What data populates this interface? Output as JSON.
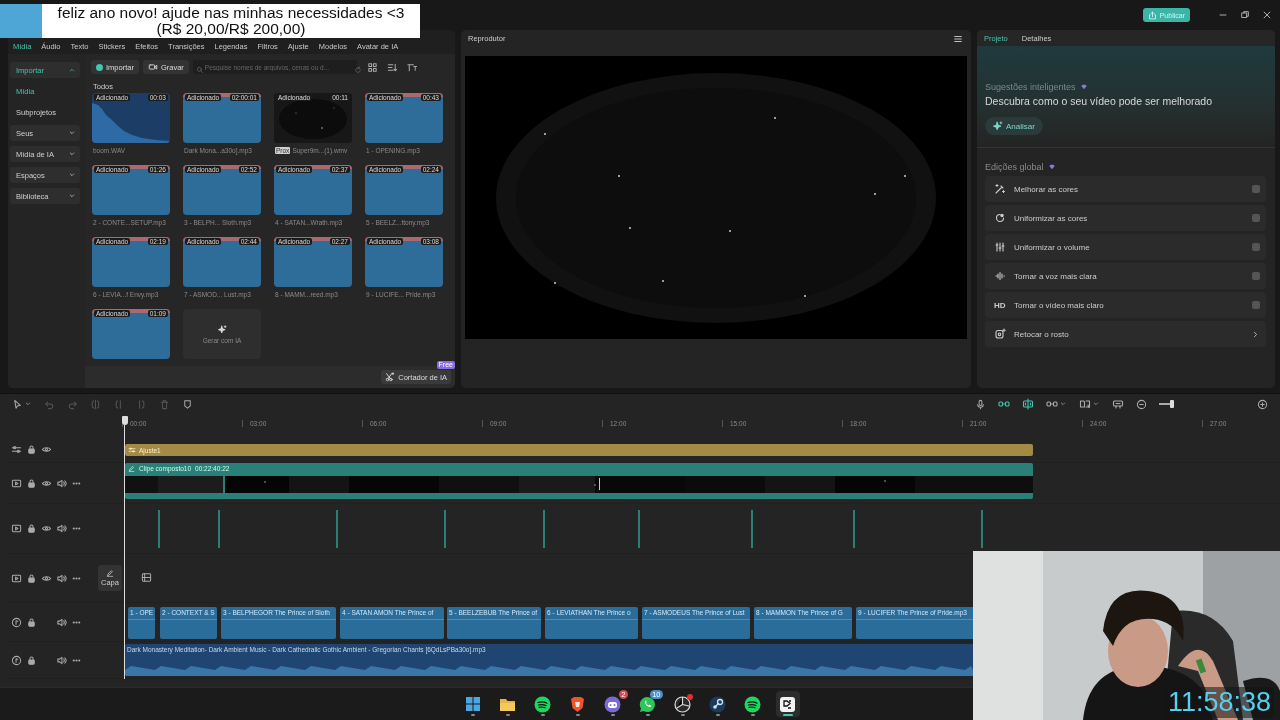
{
  "donation_banner": {
    "lines": [
      "feliz ano novo! ajude nas minhas necessidades <3",
      "(R$ 20,00/R$ 200,00)"
    ]
  },
  "title_bar": {
    "publish_button": "Publicar"
  },
  "media_tabs": [
    {
      "label": "Mídia",
      "selected": true
    },
    {
      "label": "Áudio",
      "selected": false
    },
    {
      "label": "Texto",
      "selected": false
    },
    {
      "label": "Stickers",
      "selected": false
    },
    {
      "label": "Efeitos",
      "selected": false
    },
    {
      "label": "Transições",
      "selected": false
    },
    {
      "label": "Legendas",
      "selected": false
    },
    {
      "label": "Filtros",
      "selected": false
    },
    {
      "label": "Ajuste",
      "selected": false
    },
    {
      "label": "Modelos",
      "selected": false
    },
    {
      "label": "Avatar de IA",
      "selected": false
    }
  ],
  "media_sidebar": [
    {
      "label": "Importar",
      "kind": "group",
      "expanded": true,
      "selected": true
    },
    {
      "label": "Mídia",
      "kind": "link",
      "selected": true
    },
    {
      "label": "Subprojetos",
      "kind": "link",
      "selected": false
    },
    {
      "label": "Seus",
      "kind": "group",
      "expanded": false,
      "selected": false
    },
    {
      "label": "Mídia de IA",
      "kind": "group",
      "expanded": false,
      "selected": false
    },
    {
      "label": "Espaços",
      "kind": "group",
      "expanded": false,
      "selected": false
    },
    {
      "label": "Biblioteca",
      "kind": "group",
      "expanded": false,
      "selected": false
    }
  ],
  "media_toolbar": {
    "import_button": "Importar",
    "record_button": "Gravar",
    "search_placeholder": "Pesquise nomes de arquivos, cenas ou d..."
  },
  "media_section": "Todos",
  "media_items": [
    {
      "kind": "sfx",
      "status": "Adicionado",
      "duration": "00:03",
      "name": "boom.WAV"
    },
    {
      "kind": "audio",
      "status": "Adicionado",
      "duration": "02:00:01",
      "name": "Dark Mona...a30o].mp3"
    },
    {
      "kind": "video",
      "status": "Adicionado",
      "duration": "00:11",
      "tag": "Prox",
      "name": "Super9m...(1).wmv"
    },
    {
      "kind": "audio",
      "status": "Adicionado",
      "duration": "00:43",
      "name": "1 - OPENING.mp3"
    },
    {
      "kind": "audio",
      "status": "Adicionado",
      "duration": "01:26",
      "name": "2 - CONTE...SETUP.mp3"
    },
    {
      "kind": "audio",
      "status": "Adicionado",
      "duration": "02:52",
      "name": "3 -  BELPH... Sloth.mp3"
    },
    {
      "kind": "audio",
      "status": "Adicionado",
      "duration": "02:37",
      "name": "4 - SATAN...Wrath.mp3"
    },
    {
      "kind": "audio",
      "status": "Adicionado",
      "duration": "02:24",
      "name": "5 - BEELZ...ttony.mp3"
    },
    {
      "kind": "audio",
      "status": "Adicionado",
      "duration": "02:19",
      "name": "6 -  LEVIA...f Envy.mp3"
    },
    {
      "kind": "audio",
      "status": "Adicionado",
      "duration": "02:44",
      "name": "7 - ASMOD... Lust.mp3"
    },
    {
      "kind": "audio",
      "status": "Adicionado",
      "duration": "02:27",
      "name": "8 - MAMM...reed.mp3"
    },
    {
      "kind": "audio",
      "status": "Adicionado",
      "duration": "03:08",
      "name": "9 - LUCIFE... Pride.mp3"
    },
    {
      "kind": "audio",
      "status": "Adicionado",
      "duration": "01:09"
    }
  ],
  "generate_tile": "Gerar com IA",
  "ai_cutter": {
    "label": "Cortador de IA",
    "badge": "Free"
  },
  "player": {
    "title": "Reprodutor"
  },
  "inspector": {
    "tabs": [
      {
        "label": "Projeto",
        "selected": true
      },
      {
        "label": "Detalhes",
        "selected": false
      }
    ],
    "suggestions": {
      "label": "Sugestões inteligentes",
      "headline": "Descubra como o seu vídeo pode ser melhorado",
      "button": "Analisar"
    },
    "global_edits": {
      "heading": "Edições global",
      "items": [
        {
          "kind": "toggle",
          "label": "Melhorar as cores",
          "on": false
        },
        {
          "kind": "toggle",
          "label": "Uniformizar as cores",
          "on": false
        },
        {
          "kind": "toggle",
          "label": "Uniformizar o volume",
          "on": false
        },
        {
          "kind": "toggle",
          "label": "Tornar a voz mais clara",
          "on": false
        },
        {
          "kind": "toggle",
          "icon_text": "HD",
          "label": "Tornar o vídeo mais claro",
          "on": false
        },
        {
          "kind": "link",
          "label": "Retocar o rosto"
        }
      ]
    }
  },
  "timeline": {
    "zoom_slider": {
      "level": 0.9
    },
    "ruler": [
      "00:00",
      "03:00",
      "06:00",
      "09:00",
      "12:00",
      "15:00",
      "18:00",
      "21:00",
      "24:00",
      "27:00"
    ],
    "tracks": [
      {
        "kind": "adjustment",
        "clip": "Ajuste1"
      },
      {
        "kind": "composite",
        "name": "Clipe composto10",
        "duration": "00:22:40:22"
      },
      {
        "kind": "markers"
      },
      {
        "kind": "cover",
        "button": "Capa"
      },
      {
        "kind": "audio",
        "clips": [
          "1 - OPE",
          "2 - CONTEXT & S",
          "3 -  BELPHEGOR The Prince of Sloth",
          "4 - SATAN AMON The Prince of",
          "5 - BEELZEBUB The Prince of",
          "6 -  LEVIATHAN The Prince o",
          "7 - ASMODEUS The Prince of Lust",
          "8 - MAMMON The Prince of G",
          "9 - LUCIFER The Prince of Pride.mp3"
        ]
      },
      {
        "kind": "music",
        "clip": "Dark Monastery Meditation- Dark Ambient Music - Dark Cathedralic Gothic Ambient - Gregorian Chants [6QdLsPBa30o].mp3"
      }
    ]
  },
  "webcam": {
    "clock": "11:58:38"
  },
  "taskbar": [
    {
      "selected": false
    },
    {
      "selected": false
    },
    {
      "selected": false
    },
    {
      "selected": false
    },
    {
      "badge": "2",
      "color": "#d84a4a",
      "selected": false
    },
    {
      "badge": "10",
      "color": "#4a8fd0",
      "selected": false
    },
    {
      "dot": true,
      "selected": false
    },
    {
      "selected": false
    },
    {
      "selected": false
    },
    {
      "selected": true
    }
  ]
}
